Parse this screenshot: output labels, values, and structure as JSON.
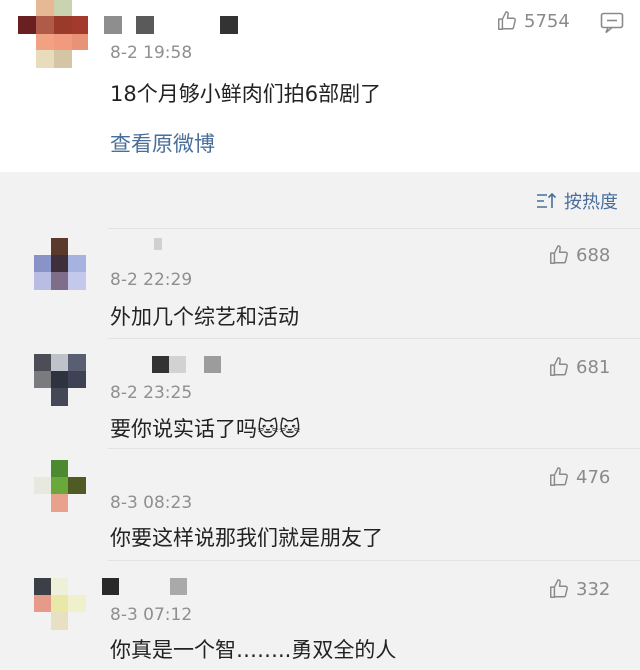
{
  "main": {
    "time": "8-2 19:58",
    "text": "18个月够小鲜肉们拍6部剧了",
    "likes": "5754",
    "view_original": "查看原微博"
  },
  "sort": {
    "label": "按热度"
  },
  "comments": [
    {
      "time": "8-2 22:29",
      "text": "外加几个综艺和活动",
      "likes": "688"
    },
    {
      "time": "8-2 23:25",
      "text": "要你说实话了吗🐱🐱",
      "likes": "681"
    },
    {
      "time": "8-3 08:23",
      "text": "你要这样说那我们就是朋友了",
      "likes": "476"
    },
    {
      "time": "8-3 07:12",
      "text": "你真是一个智……..勇双全的人",
      "likes": "332"
    }
  ],
  "colors": {
    "link": "#4a6e9a",
    "meta": "#8f8f8f",
    "text": "#222222"
  },
  "icons": {
    "like": "thumbs-up-icon",
    "comment": "comment-icon",
    "sort": "sort-icon"
  }
}
